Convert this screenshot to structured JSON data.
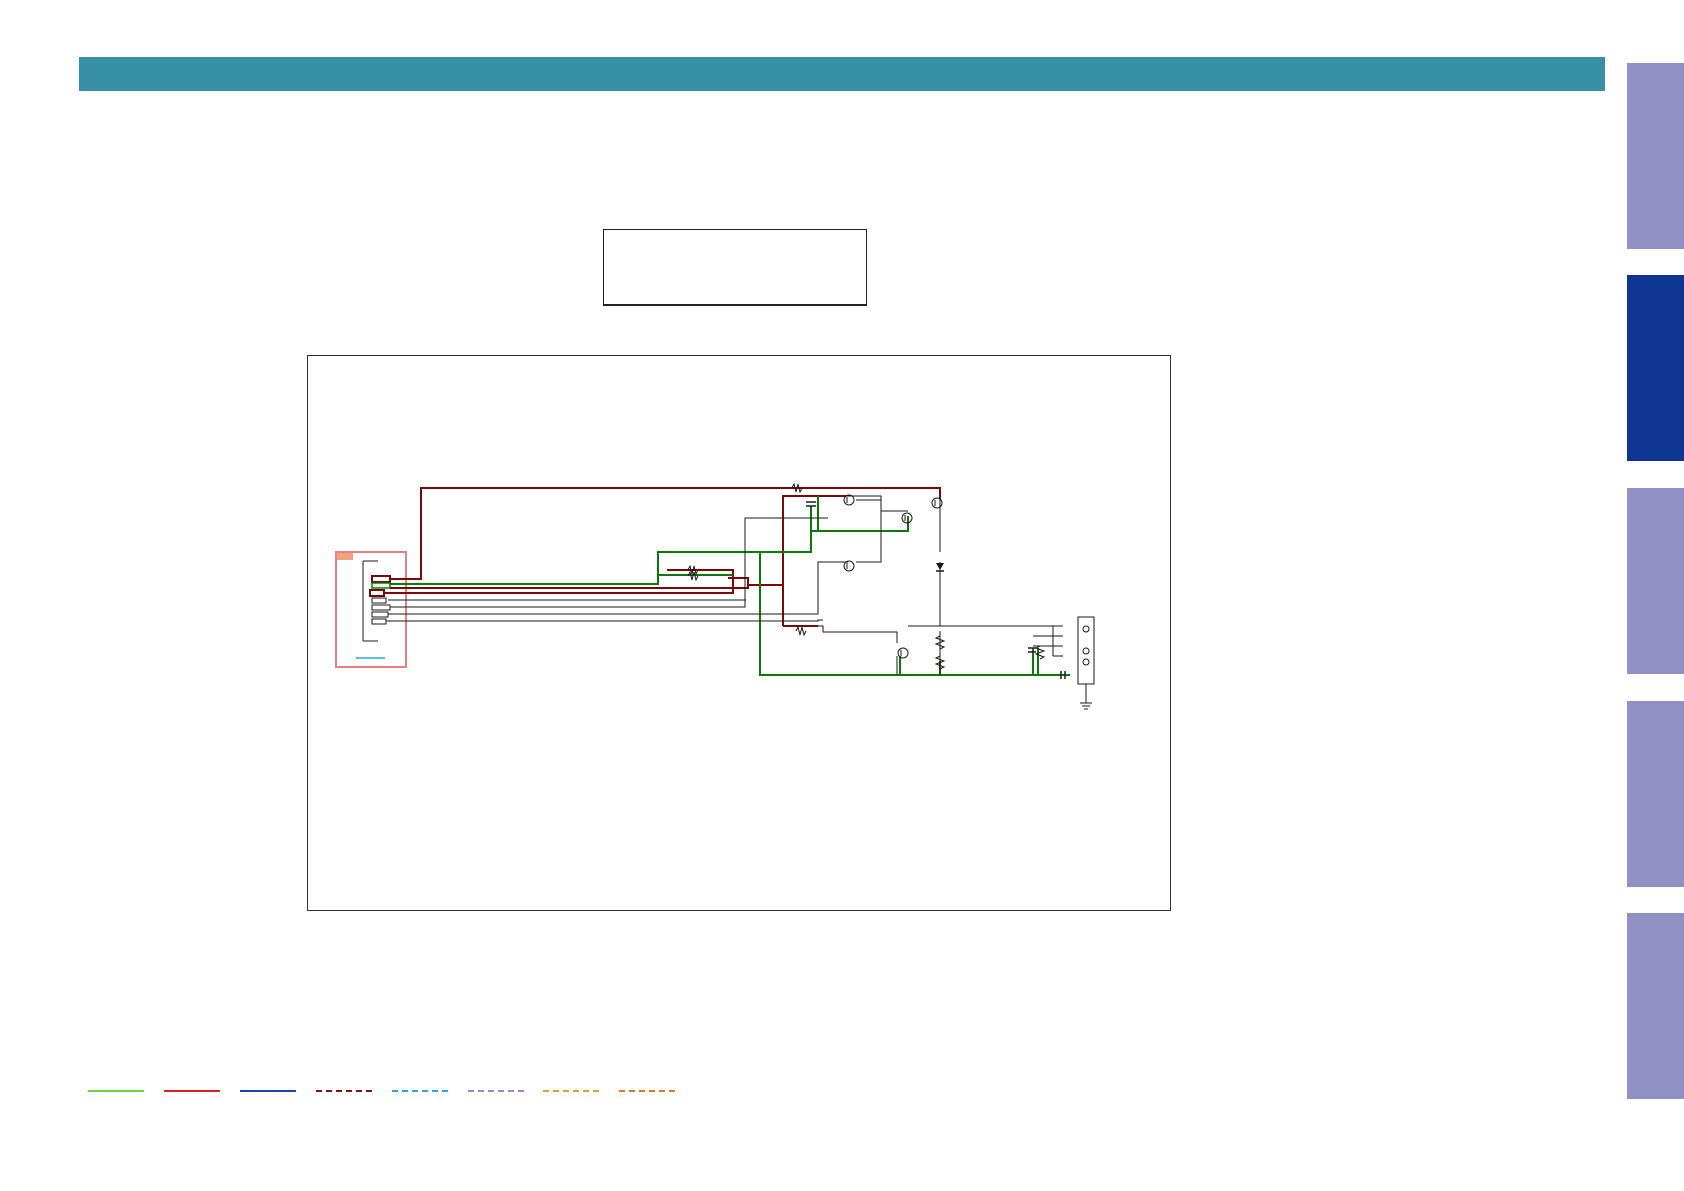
{
  "header": {
    "color": "#3890a6"
  },
  "side_tabs": [
    {
      "name": "tab-1",
      "color": "#9190c4",
      "active": false
    },
    {
      "name": "tab-2",
      "color": "#0f3593",
      "active": true
    },
    {
      "name": "tab-3",
      "color": "#9190c4",
      "active": false
    },
    {
      "name": "tab-4",
      "color": "#9190c4",
      "active": false
    },
    {
      "name": "tab-5",
      "color": "#9190c4",
      "active": false
    }
  ],
  "schematic": {
    "colors": {
      "power_dark_red": "#7a0a0a",
      "ground_green": "#0a7a0a",
      "signal_black": "#1a1a1a",
      "connector_highlight": "#e88080",
      "connector_label_fill": "#f2a080",
      "connector_underline": "#2aa6d8"
    }
  },
  "legend": {
    "items": [
      {
        "name": "legend-green-solid",
        "color": "#66dd33",
        "style": "solid"
      },
      {
        "name": "legend-red-solid",
        "color": "#dd2222",
        "style": "solid"
      },
      {
        "name": "legend-blue-solid",
        "color": "#1a44b0",
        "style": "solid"
      },
      {
        "name": "legend-darkred-dashed",
        "color": "#8a1010",
        "style": "dashed"
      },
      {
        "name": "legend-cyan-dashed",
        "color": "#2aa6e0",
        "style": "dashed"
      },
      {
        "name": "legend-lavender-dashed",
        "color": "#8f86e6",
        "style": "dashed"
      },
      {
        "name": "legend-orange-dashed",
        "color": "#e6a030",
        "style": "dashed"
      },
      {
        "name": "legend-darkorange-dashed",
        "color": "#e07820",
        "style": "dashed"
      }
    ]
  }
}
